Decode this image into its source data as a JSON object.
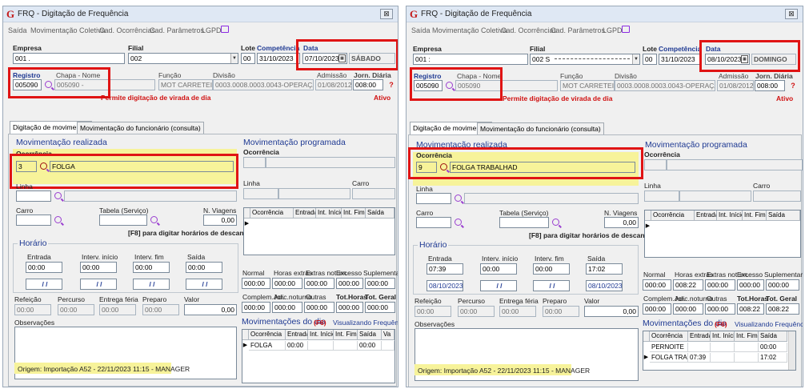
{
  "left": {
    "title": "FRQ - Digitação de Frequência",
    "close": "⊠",
    "menu": [
      "Saída",
      "Movimentação Coletiva",
      "Cad. Ocorrências",
      "Cad. Parâmetros",
      "LGPD"
    ],
    "empresa_label": "Empresa",
    "empresa_value": "001 .",
    "filial_label": "Filial",
    "filial_value": "002",
    "lote_label": "Lote",
    "lote_value": "00",
    "competencia_label": "Competência",
    "competencia_value": "31/10/2023",
    "data_label": "Data",
    "data_value": "07/10/2023",
    "weekday": "SÁBADO",
    "registro_label": "Registro",
    "registro_value": "005090",
    "chapa_label": "Chapa - Nome",
    "chapa_value": "005090 -",
    "funcao_label": "Função",
    "funcao_value": "MOT CARRETEIRO",
    "divisao_label": "Divisão",
    "divisao_value": "0003.0008.0003.0043-OPERAÇÃO",
    "admissao_label": "Admissão",
    "admissao_value": "01/08/2012",
    "jorn_label": "Jorn. Diária",
    "jorn_value": "008:00",
    "virada_msg": "Permite digitação de virada de dia",
    "status": "Ativo",
    "help": "?",
    "tab1": "Digitação de movimentos",
    "tab2": "Movimentação do funcionário (consulta)",
    "mov_realizada": "Movimentação realizada",
    "ocorrencia_label": "Ocorrência",
    "ocorrencia_code": "3",
    "ocorrencia_desc": "FOLGA",
    "linha_label": "Linha",
    "carro_label": "Carro",
    "tabela_label": "Tabela (Serviço)",
    "nviagens_label": "N. Viagens",
    "nviagens_value": "0,00",
    "f8_msg": "[F8] para digitar horários de descanso",
    "horario_label": "Horário",
    "entrada_label": "Entrada",
    "intini_label": "Interv. início",
    "intfim_label": "Interv. fim",
    "saida_label": "Saída",
    "entrada_value": "00:00",
    "intini_value": "00:00",
    "intfim_value": "00:00",
    "saida_value": "00:00",
    "entrada_date": "/ /",
    "intini_date": "/ /",
    "intfim_date": "/ /",
    "saida_date": "/ /",
    "refeicao_label": "Refeição",
    "percurso_label": "Percurso",
    "entrega_label": "Entrega féria",
    "preparo_label": "Preparo",
    "valor_label": "Valor",
    "refeicao_value": "00:00",
    "percurso_value": "00:00",
    "entrega_value": "00:00",
    "preparo_value": "00:00",
    "valor_value": "0,00",
    "obs_label": "Observações",
    "origem": "Origem: Importação A52 - 22/11/2023 11:15 - MANAGER",
    "mov_programada": "Movimentação programada",
    "prog_ocorrencia_label": "Ocorrência",
    "prog_linha_label": "Linha",
    "prog_carro_label": "Carro",
    "prog_cols": [
      "Ocorrência",
      "Entrada",
      "Int. Início",
      "Int. Fim",
      "Saída"
    ],
    "tot_labels1": [
      "Normal",
      "Horas extras",
      "Extras noturn.",
      "Excesso",
      "Suplementar"
    ],
    "tot_values1": [
      "000:00",
      "000:00",
      "000:00",
      "000:00",
      "000:00"
    ],
    "tot_labels2": [
      "Complem.Jor.",
      "Adic.noturno",
      "Outras",
      "Tot.Horas",
      "Tot. Geral"
    ],
    "tot_values2": [
      "000:00",
      "000:00",
      "000:00",
      "000:00",
      "000:00"
    ],
    "movdia_label": "Movimentações do dia",
    "movdia_f6": "(F6)",
    "visualizando": "Visualizando Frequência",
    "day_cols": [
      "Ocorrência",
      "Entrada",
      "Int. Início",
      "Int. Fim",
      "Saída",
      "Va"
    ],
    "day_rows": [
      {
        "ind": "▶",
        "cells": [
          "FOLGA",
          "00:00",
          "",
          "",
          "00:00",
          ""
        ]
      }
    ]
  },
  "right": {
    "title": "FRQ - Digitação de Frequência",
    "close": "⊠",
    "menu": [
      "Saída",
      "Movimentação Coletiva",
      "Cad. Ocorrências",
      "Cad. Parâmetros",
      "LGPD"
    ],
    "empresa_label": "Empresa",
    "empresa_value": "001 :",
    "filial_label": "Filial",
    "filial_value": "002 S",
    "lote_label": "Lote",
    "lote_value": "00",
    "competencia_label": "Competência",
    "competencia_value": "31/10/2023",
    "data_label": "Data",
    "data_value": "08/10/2023",
    "weekday": "DOMINGO",
    "registro_label": "Registro",
    "registro_value": "005090",
    "chapa_label": "Chapa - Nome",
    "chapa_value": "005090",
    "funcao_label": "Função",
    "funcao_value": "MOT CARRETEIRO",
    "divisao_label": "Divisão",
    "divisao_value": "0003.0008.0003.0043-OPERAÇÃO",
    "admissao_label": "Admissão",
    "admissao_value": "01/08/2012",
    "jorn_label": "Jorn. Diária",
    "jorn_value": "008:00",
    "virada_msg": "Permite digitação de virada de dia",
    "status": "Ativo",
    "help": "?",
    "tab1": "Digitação de movimentos",
    "tab2": "Movimentação do funcionário (consulta)",
    "mov_realizada": "Movimentação realizada",
    "ocorrencia_label": "Ocorrência",
    "ocorrencia_code": "9",
    "ocorrencia_desc": "FOLGA TRABALHAD",
    "linha_label": "Linha",
    "carro_label": "Carro",
    "tabela_label": "Tabela (Serviço)",
    "nviagens_label": "N. Viagens",
    "nviagens_value": "0,00",
    "f8_msg": "[F8] para digitar horários de descanso",
    "horario_label": "Horário",
    "entrada_label": "Entrada",
    "intini_label": "Interv. início",
    "intfim_label": "Interv. fim",
    "saida_label": "Saída",
    "entrada_value": "07:39",
    "intini_value": "00:00",
    "intfim_value": "00:00",
    "saida_value": "17:02",
    "entrada_date": "08/10/2023",
    "intini_date": "/ /",
    "intfim_date": "/ /",
    "saida_date": "08/10/2023",
    "refeicao_label": "Refeição",
    "percurso_label": "Percurso",
    "entrega_label": "Entrega féria",
    "preparo_label": "Preparo",
    "valor_label": "Valor",
    "refeicao_value": "00:00",
    "percurso_value": "00:00",
    "entrega_value": "00:00",
    "preparo_value": "00:00",
    "valor_value": "0,00",
    "obs_label": "Observações",
    "origem": "Origem: Importação A52 - 22/11/2023 11:15 - MANAGER",
    "mov_programada": "Movimentação programada",
    "prog_ocorrencia_label": "Ocorrência",
    "prog_linha_label": "Linha",
    "prog_carro_label": "Carro",
    "prog_cols": [
      "Ocorrência",
      "Entrada",
      "Int. Início",
      "Int. Fim",
      "Saída"
    ],
    "tot_labels1": [
      "Normal",
      "Horas extras",
      "Extras noturn.",
      "Excesso",
      "Suplementar"
    ],
    "tot_values1": [
      "000:00",
      "008:22",
      "000:00",
      "000:00",
      "000:00"
    ],
    "tot_labels2": [
      "Complem.Jor.",
      "Adic.noturno",
      "Outras",
      "Tot.Horas",
      "Tot. Geral"
    ],
    "tot_values2": [
      "000:00",
      "000:00",
      "000:00",
      "008:22",
      "008:22"
    ],
    "movdia_label": "Movimentações do dia",
    "movdia_f6": "(F6)",
    "visualizando": "Visualizando Frequência",
    "day_cols": [
      "Ocorrência",
      "Entrada",
      "Int. Início",
      "Int. Fim",
      "Saída"
    ],
    "day_rows": [
      {
        "ind": "",
        "cells": [
          "PERNOITE",
          "",
          "",
          "",
          "00:00"
        ]
      },
      {
        "ind": "▶",
        "cells": [
          "FOLGA TRABA",
          "07:39",
          "",
          "",
          "17:02"
        ]
      }
    ]
  },
  "colors": {
    "highlight": "#e01414",
    "section_blue": "#1f3a93",
    "yellow_bar": "#f7f39a",
    "title_red": "#c41a1a"
  }
}
